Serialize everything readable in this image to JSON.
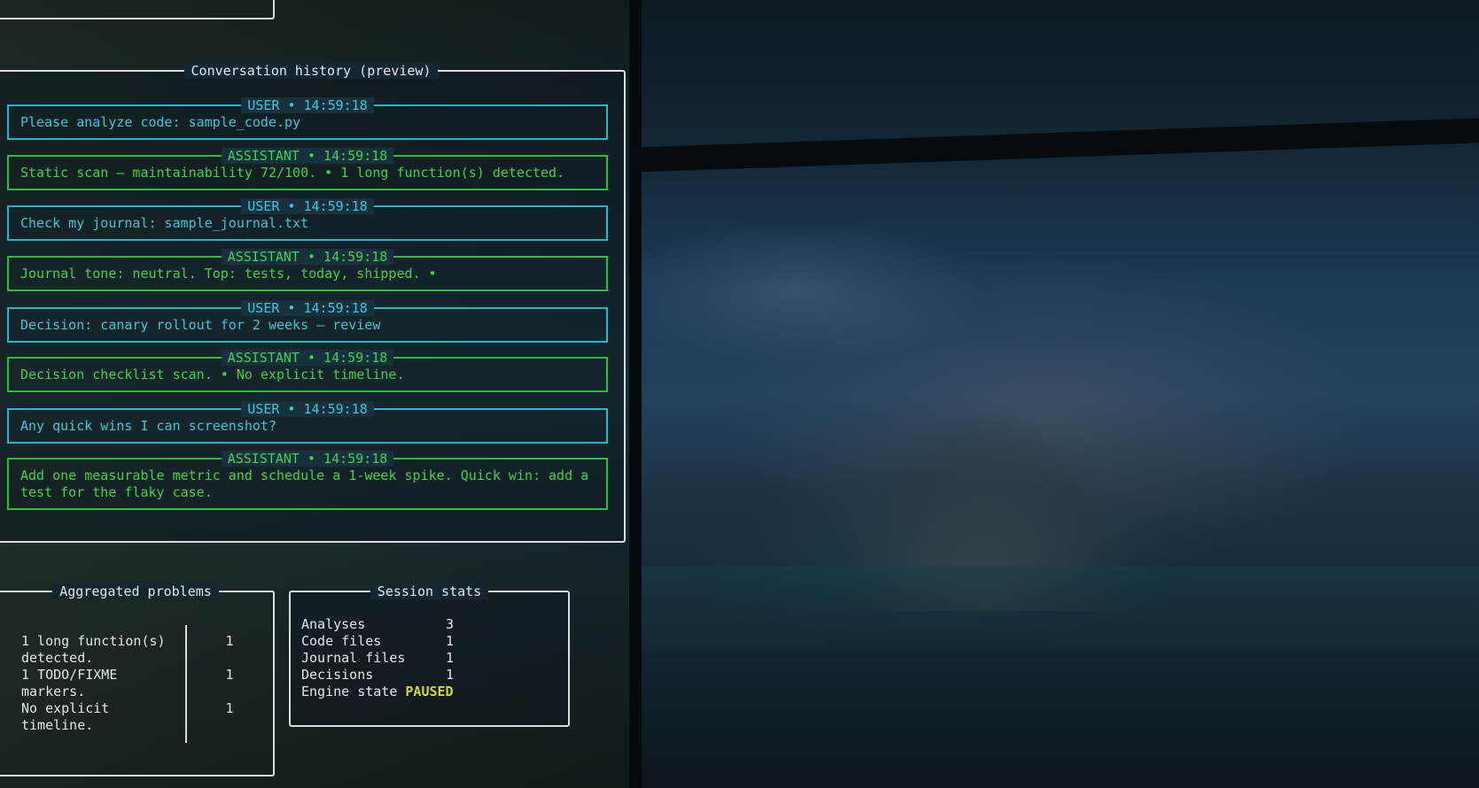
{
  "conversation": {
    "title": "Conversation history (preview)",
    "messages": [
      {
        "role": "user",
        "header": "USER • 14:59:18",
        "text": "Please analyze code: sample_code.py"
      },
      {
        "role": "assistant",
        "header": "ASSISTANT • 14:59:18",
        "text": "Static scan — maintainability 72/100. • 1 long function(s) detected."
      },
      {
        "role": "user",
        "header": "USER • 14:59:18",
        "text": "Check my journal: sample_journal.txt"
      },
      {
        "role": "assistant",
        "header": "ASSISTANT • 14:59:18",
        "text": "Journal tone: neutral. Top: tests, today, shipped. •"
      },
      {
        "role": "user",
        "header": "USER • 14:59:18",
        "text": "Decision: canary rollout for 2 weeks — review"
      },
      {
        "role": "assistant",
        "header": "ASSISTANT • 14:59:18",
        "text": "Decision checklist scan. • No explicit timeline."
      },
      {
        "role": "user",
        "header": "USER • 14:59:18",
        "text": "Any quick wins I can screenshot?"
      },
      {
        "role": "assistant",
        "header": "ASSISTANT • 14:59:18",
        "text": "Add one measurable metric and schedule a 1-week spike. Quick win: add a\ntest for the flaky case."
      }
    ]
  },
  "problems": {
    "title": "Aggregated problems",
    "rows": [
      {
        "text": "1 long function(s)\ndetected.",
        "count": "1"
      },
      {
        "text": "1 TODO/FIXME\nmarkers.",
        "count": "1"
      },
      {
        "text": "No explicit\ntimeline.",
        "count": "1"
      }
    ]
  },
  "stats": {
    "title": "Session stats",
    "rows": [
      {
        "label": "Analyses",
        "value": "3"
      },
      {
        "label": "Code files",
        "value": "1"
      },
      {
        "label": "Journal files",
        "value": "1"
      },
      {
        "label": "Decisions",
        "value": "1"
      }
    ],
    "engine_label": "Engine state",
    "engine_value": "PAUSED"
  },
  "colors": {
    "user": "#38c8dc",
    "assistant": "#3fd24c",
    "paused": "#d4d53a",
    "border": "#d9dde2"
  }
}
